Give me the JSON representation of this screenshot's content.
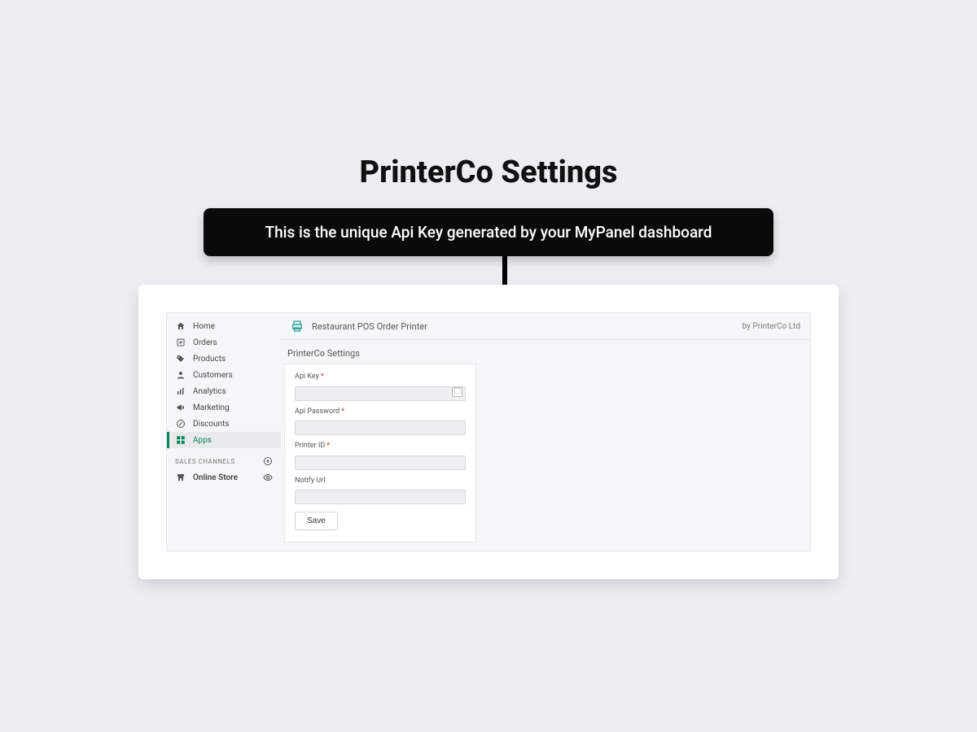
{
  "heading": "PrinterCo Settings",
  "callout_text": "This is the unique Api Key generated by your MyPanel dashboard",
  "sidebar": {
    "items": [
      {
        "label": "Home"
      },
      {
        "label": "Orders"
      },
      {
        "label": "Products"
      },
      {
        "label": "Customers"
      },
      {
        "label": "Analytics"
      },
      {
        "label": "Marketing"
      },
      {
        "label": "Discounts"
      },
      {
        "label": "Apps"
      }
    ],
    "channels_label": "SALES CHANNELS",
    "online_store_label": "Online Store"
  },
  "app_bar": {
    "title": "Restaurant POS Order Printer",
    "vendor": "by PrinterCo Ltd"
  },
  "settings": {
    "section_title": "PrinterCo Settings",
    "api_key": {
      "label": "Api Key",
      "required": true,
      "value": ""
    },
    "api_password": {
      "label": "Api Password",
      "required": true,
      "value": ""
    },
    "printer_id": {
      "label": "Printer ID",
      "required": true,
      "value": ""
    },
    "notify_url": {
      "label": "Notify Url",
      "required": false,
      "value": ""
    },
    "save_label": "Save"
  }
}
